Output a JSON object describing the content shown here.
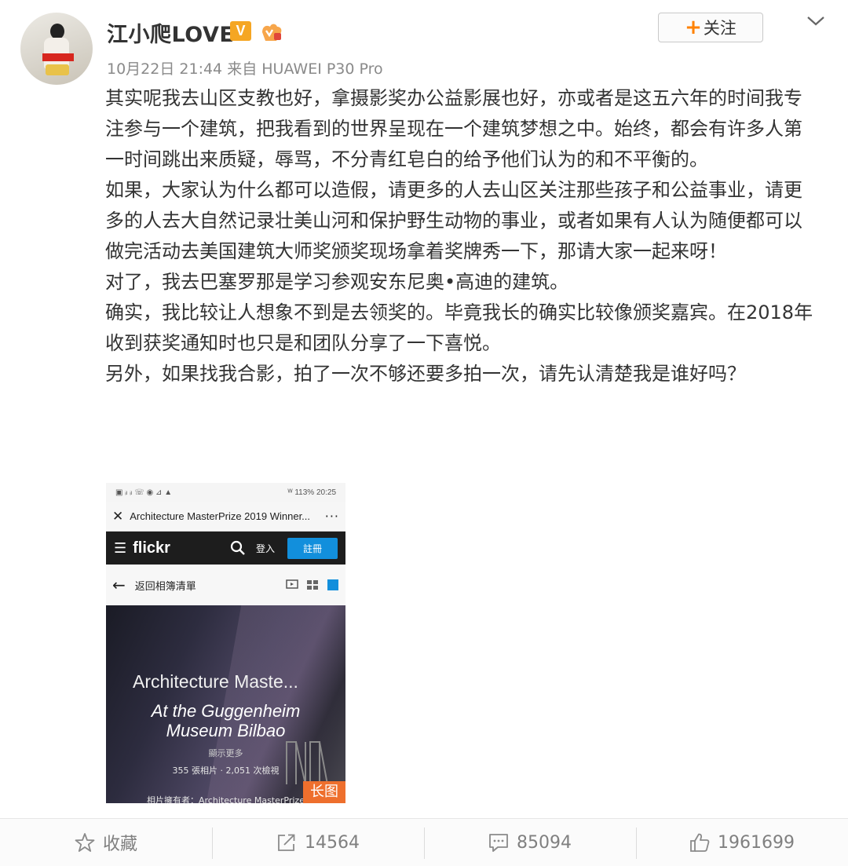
{
  "user": {
    "name": "江小爬LOVE",
    "verified_badge": "V",
    "follow_label": "关注",
    "follow_plus": "+"
  },
  "post": {
    "date": "10月22日 21:44",
    "source_prefix": "来自",
    "source": "HUAWEI P30 Pro",
    "paragraphs": [
      "其实呢我去山区支教也好，拿摄影奖办公益影展也好，亦或者是这五六年的时间我专注参与一个建筑，把我看到的世界呈现在一个建筑梦想之中。始终，都会有许多人第一时间跳出来质疑，辱骂，不分青红皂白的给予他们认为的和不平衡的。",
      "如果，大家认为什么都可以造假，请更多的人去山区关注那些孩子和公益事业，请更多的人去大自然记录壮美山河和保护野生动物的事业，或者如果有人认为随便都可以做完活动去美国建筑大师奖颁奖现场拿着奖牌秀一下，那请大家一起来呀！",
      "对了，我去巴塞罗那是学习参观安东尼奥•高迪的建筑。",
      "确实，我比较让人想象不到是去领奖的。毕竟我长的确实比较像颁奖嘉宾。在2018年收到获奖通知时也只是和团队分享了一下喜悦。",
      "另外，如果找我合影，拍了一次不够还要多拍一次，请先认清楚我是谁好吗？"
    ]
  },
  "embedded_screenshot": {
    "status_time": "20:25",
    "status_left": "▣ ᵢₗ ᵢₗ ☏ ◉ ⊿ ▲",
    "status_right": "ᵂ 113% 20:25",
    "tab_title": "Architecture MasterPrize 2019 Winner...",
    "tab_more": "···",
    "site_logo": "flickr",
    "login": "登入",
    "register": "註冊",
    "back_label": "返回相簿清單",
    "album_title": "Architecture Maste...",
    "album_subtitle_1": "At the Guggenheim",
    "album_subtitle_2": "Museum Bilbao",
    "show_more": "顯示更多",
    "stats": "355 張相片  ·  2,051 次檢視",
    "owner": "相片擁有者：Architecture MasterPrize",
    "long_image_tag": "长图"
  },
  "actions": {
    "favorite": "收藏",
    "reposts": "14564",
    "comments": "85094",
    "likes": "1961699"
  },
  "colors": {
    "accent_orange": "#ff8200",
    "verified_yellow": "#f5a623",
    "flickr_blue": "#128fdc"
  },
  "icons": [
    "verified-v-icon",
    "vip-icon",
    "chevron-down-icon",
    "close-icon",
    "menu-icon",
    "search-icon",
    "back-arrow-icon",
    "slideshow-icon",
    "grid-icon",
    "star-icon",
    "share-icon",
    "comment-icon",
    "like-icon"
  ]
}
